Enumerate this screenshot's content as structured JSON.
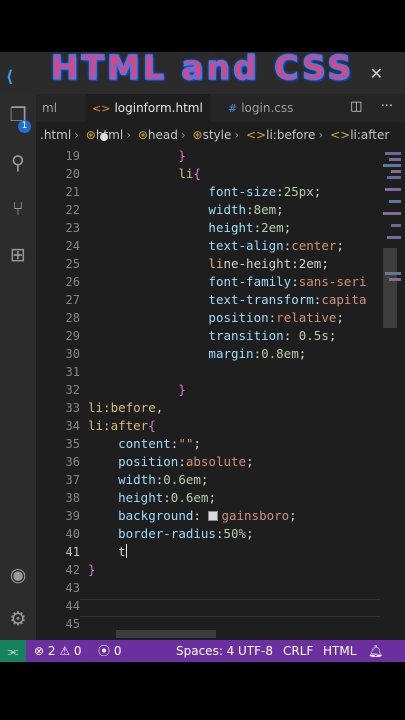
{
  "overlay": {
    "title": "HTML and CSS"
  },
  "tabs": [
    {
      "label": "ml"
    },
    {
      "label": "loginform.html",
      "icon": "html-file-icon"
    },
    {
      "label": "login.css",
      "icon": "css-file-icon"
    }
  ],
  "breadcrumbs": [
    ".html",
    "html",
    "head",
    "style",
    "li:before",
    "li:after"
  ],
  "activity": {
    "source_control_badge": "1"
  },
  "editor": {
    "current_line": "41",
    "lines": [
      {
        "n": "19",
        "text": "            }"
      },
      {
        "n": "20",
        "text": "            li{"
      },
      {
        "n": "21",
        "text": "                font-size:25px;"
      },
      {
        "n": "22",
        "text": "                width:8em;"
      },
      {
        "n": "23",
        "text": "                height:2em;"
      },
      {
        "n": "24",
        "text": "                text-align:center;"
      },
      {
        "n": "25",
        "text": "                line-height:2em;"
      },
      {
        "n": "26",
        "text": "                font-family:sans-seri"
      },
      {
        "n": "27",
        "text": "                text-transform:capita"
      },
      {
        "n": "28",
        "text": "                position:relative;"
      },
      {
        "n": "29",
        "text": "                transition: 0.5s;"
      },
      {
        "n": "30",
        "text": "                margin:0.8em;"
      },
      {
        "n": "31",
        "text": ""
      },
      {
        "n": "32",
        "text": "            }"
      },
      {
        "n": "33",
        "text": "li:before,"
      },
      {
        "n": "34",
        "text": "li:after{"
      },
      {
        "n": "35",
        "text": "    content:\"\";"
      },
      {
        "n": "36",
        "text": "    position:absolute;"
      },
      {
        "n": "37",
        "text": "    width:0.6em;"
      },
      {
        "n": "38",
        "text": "    height:0.6em;"
      },
      {
        "n": "39",
        "text": "    background: gainsboro;"
      },
      {
        "n": "40",
        "text": "    border-radius:50%;"
      },
      {
        "n": "41",
        "text": "    t"
      },
      {
        "n": "42",
        "text": "}"
      },
      {
        "n": "43",
        "text": ""
      },
      {
        "n": "44",
        "text": ""
      },
      {
        "n": "45",
        "text": ""
      }
    ]
  },
  "status": {
    "errors": "2",
    "warnings": "0",
    "ports": "0",
    "spaces": "Spaces: 4",
    "encoding": "UTF-8",
    "eol": "CRLF",
    "language": "HTML"
  },
  "colors": {
    "statusbar": "#6b2fa0",
    "remote": "#16825d",
    "selector": "#d7ba7d",
    "property": "#9cdcfe",
    "value": "#ce9178"
  }
}
